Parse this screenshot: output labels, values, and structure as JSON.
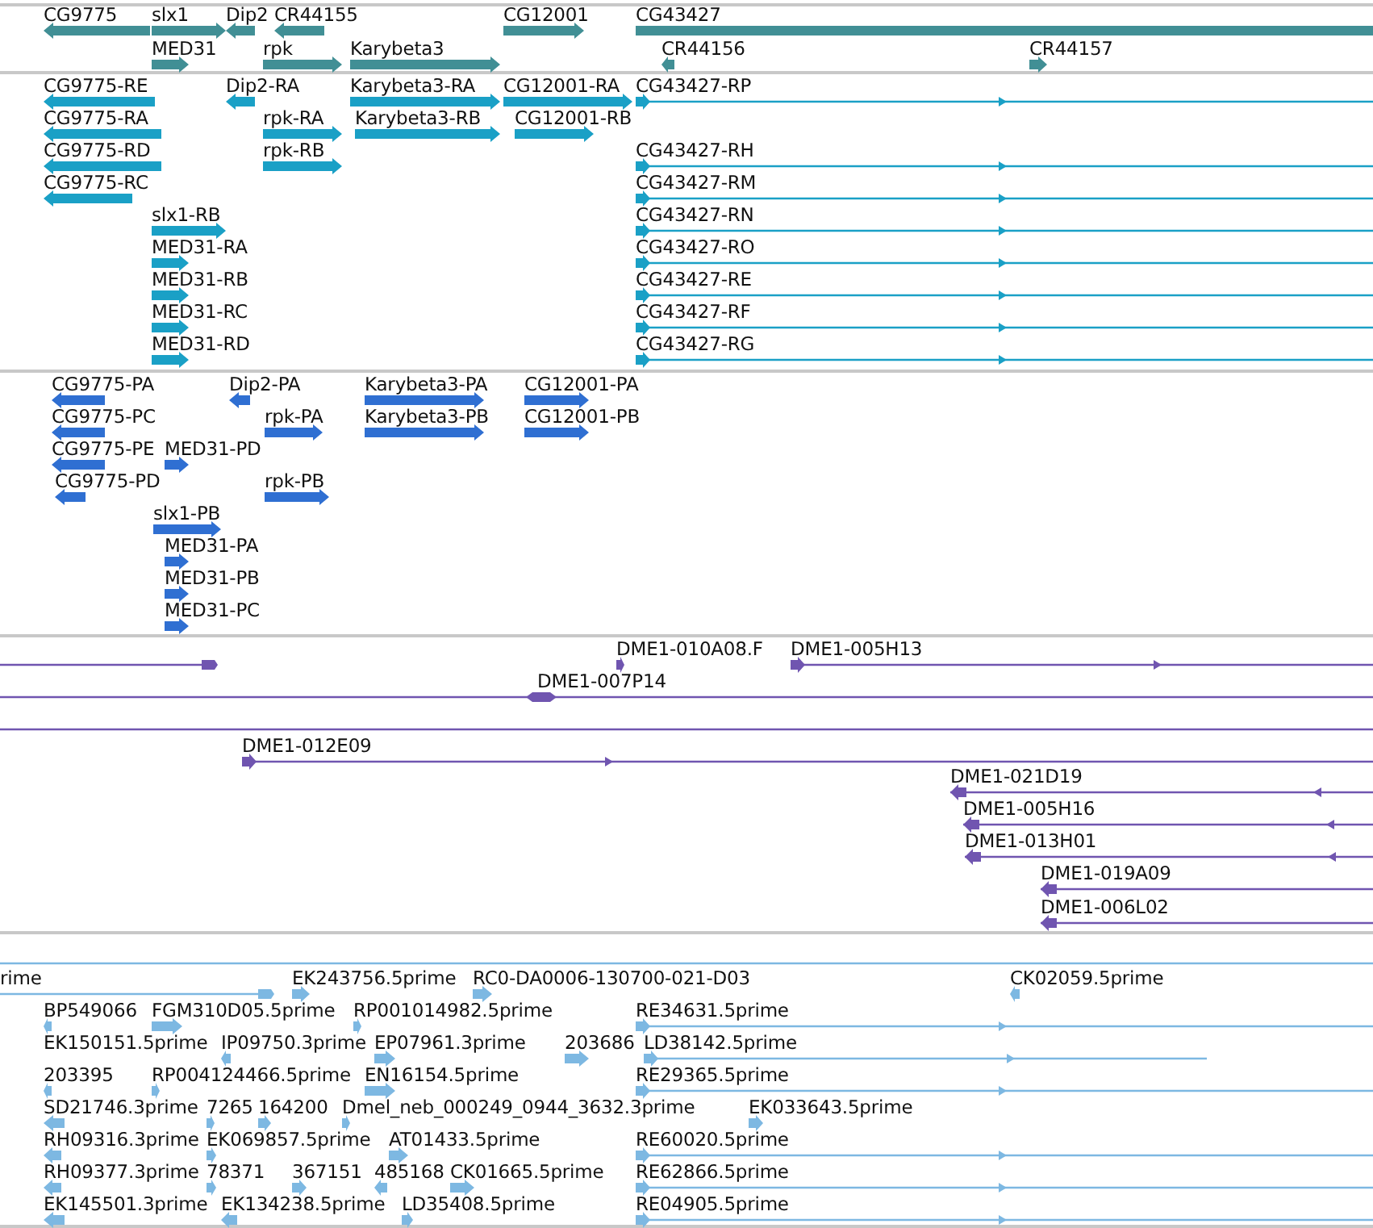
{
  "tracks": [
    {
      "kind": "gene",
      "features": [
        {
          "label": "CG9775",
          "reverse": true
        },
        {
          "label": "slx1",
          "reverse": false
        },
        {
          "label": "Dip2",
          "reverse": true
        },
        {
          "label": "CR44155",
          "reverse": true
        },
        {
          "label": "CG12001",
          "reverse": false
        },
        {
          "label": "CG43427"
        },
        {
          "label": "MED31",
          "reverse": false
        },
        {
          "label": "rpk",
          "reverse": false
        },
        {
          "label": "Karybeta3",
          "reverse": false
        },
        {
          "label": "CR44156",
          "reverse": true
        },
        {
          "label": "CR44157",
          "reverse": false
        }
      ]
    },
    {
      "kind": "transcript",
      "features": [
        {
          "label": "CG9775-RE",
          "reverse": true
        },
        {
          "label": "Dip2-RA",
          "reverse": true
        },
        {
          "label": "Karybeta3-RA",
          "reverse": false
        },
        {
          "label": "CG12001-RA",
          "reverse": false
        },
        {
          "label": "CG43427-RP",
          "reverse": false
        },
        {
          "label": "CG9775-RA",
          "reverse": true
        },
        {
          "label": "rpk-RA",
          "reverse": false
        },
        {
          "label": "Karybeta3-RB",
          "reverse": false
        },
        {
          "label": "CG12001-RB",
          "reverse": false
        },
        {
          "label": "CG9775-RD",
          "reverse": true
        },
        {
          "label": "rpk-RB",
          "reverse": false
        },
        {
          "label": "CG43427-RH",
          "reverse": false
        },
        {
          "label": "CG9775-RC",
          "reverse": true
        },
        {
          "label": "CG43427-RM",
          "reverse": false
        },
        {
          "label": "slx1-RB",
          "reverse": false
        },
        {
          "label": "CG43427-RN",
          "reverse": false
        },
        {
          "label": "MED31-RA",
          "reverse": false
        },
        {
          "label": "CG43427-RO",
          "reverse": false
        },
        {
          "label": "MED31-RB",
          "reverse": false
        },
        {
          "label": "CG43427-RE",
          "reverse": false
        },
        {
          "label": "MED31-RC",
          "reverse": false
        },
        {
          "label": "CG43427-RF",
          "reverse": false
        },
        {
          "label": "MED31-RD",
          "reverse": false
        },
        {
          "label": "CG43427-RG",
          "reverse": false
        }
      ]
    },
    {
      "kind": "protein",
      "features": [
        {
          "label": "CG9775-PA",
          "reverse": true
        },
        {
          "label": "Dip2-PA",
          "reverse": true
        },
        {
          "label": "Karybeta3-PA",
          "reverse": false
        },
        {
          "label": "CG12001-PA",
          "reverse": false
        },
        {
          "label": "CG9775-PC",
          "reverse": true
        },
        {
          "label": "rpk-PA",
          "reverse": false
        },
        {
          "label": "Karybeta3-PB",
          "reverse": false
        },
        {
          "label": "CG12001-PB",
          "reverse": false
        },
        {
          "label": "CG9775-PE",
          "reverse": true
        },
        {
          "label": "MED31-PD",
          "reverse": false
        },
        {
          "label": "CG9775-PD",
          "reverse": true
        },
        {
          "label": "rpk-PB",
          "reverse": false
        },
        {
          "label": "slx1-PB",
          "reverse": false
        },
        {
          "label": "MED31-PA",
          "reverse": false
        },
        {
          "label": "MED31-PB",
          "reverse": false
        },
        {
          "label": "MED31-PC",
          "reverse": false
        }
      ]
    },
    {
      "kind": "clone",
      "features": [
        {
          "reverse": false
        },
        {
          "label": "DME1-010A08.F",
          "reverse": false
        },
        {
          "label": "DME1-005H13",
          "reverse": false
        },
        {
          "label": "DME1-007P14",
          "reverse": false
        },
        {
          "reverse": false
        },
        {
          "label": "DME1-012E09",
          "reverse": false
        },
        {
          "label": "DME1-021D19",
          "reverse": true
        },
        {
          "label": "DME1-005H16",
          "reverse": true
        },
        {
          "label": "DME1-013H01",
          "reverse": true
        },
        {
          "label": "DME1-019A09",
          "reverse": true
        },
        {
          "label": "DME1-006L02",
          "reverse": true
        }
      ]
    },
    {
      "kind": "est",
      "features": [
        {
          "reverse": false
        },
        {
          "label": "rime",
          "reverse": false
        },
        {
          "label": "EK243756.5prime",
          "reverse": false
        },
        {
          "label": "RC0-DA0006-130700-021-D03",
          "reverse": false
        },
        {
          "label": "CK02059.5prime",
          "reverse": true
        },
        {
          "label": "BP549066",
          "reverse": true
        },
        {
          "label": "FGM310D05.5prime",
          "reverse": false
        },
        {
          "label": "RP001014982.5prime",
          "reverse": false
        },
        {
          "label": "RE34631.5prime",
          "reverse": false
        },
        {
          "label": "EK150151.5prime"
        },
        {
          "label": "IP09750.3prime",
          "reverse": true
        },
        {
          "label": "EP07961.3prime",
          "reverse": false
        },
        {
          "label": "203686",
          "reverse": false
        },
        {
          "label": "LD38142.5prime",
          "reverse": false
        },
        {
          "label": "203395",
          "reverse": true
        },
        {
          "label": "RP004124466.5prime",
          "reverse": false
        },
        {
          "label": "EN16154.5prime",
          "reverse": false
        },
        {
          "label": "RE29365.5prime",
          "reverse": false
        },
        {
          "label": "SD21746.3prime",
          "reverse": true
        },
        {
          "label": "7265",
          "reverse": false
        },
        {
          "label": "164200",
          "reverse": false
        },
        {
          "label": "Dmel_neb_000249_0944_3632.3prime",
          "reverse": false
        },
        {
          "label": "EK033643.5prime",
          "reverse": false
        },
        {
          "label": "RH09316.3prime",
          "reverse": true
        },
        {
          "label": "EK069857.5prime",
          "reverse": false
        },
        {
          "label": "AT01433.5prime",
          "reverse": false
        },
        {
          "label": "RE60020.5prime",
          "reverse": false
        },
        {
          "label": "RH09377.3prime",
          "reverse": true
        },
        {
          "label": "78371",
          "reverse": false
        },
        {
          "label": "367151",
          "reverse": false
        },
        {
          "label": "485168",
          "reverse": true
        },
        {
          "label": "CK01665.5prime",
          "reverse": false
        },
        {
          "label": "RE62866.5prime",
          "reverse": false
        },
        {
          "label": "EK145501.3prime",
          "reverse": true
        },
        {
          "label": "EK134238.5prime",
          "reverse": true
        },
        {
          "label": "LD35408.5prime",
          "reverse": false
        },
        {
          "label": "RE04905.5prime",
          "reverse": false
        }
      ]
    }
  ]
}
